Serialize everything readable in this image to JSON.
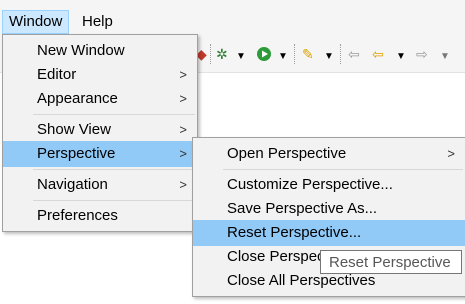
{
  "menubar": {
    "window_label": "Window",
    "help_label": "Help"
  },
  "toolbar": {
    "icons": [
      "bug-icon",
      "run-icon",
      "dropdown-icon",
      "pen-icon",
      "nav-back-icon",
      "nav-forward-icon"
    ]
  },
  "window_menu": {
    "items": [
      {
        "label": "New Window",
        "submenu": false
      },
      {
        "label": "Editor",
        "submenu": true
      },
      {
        "label": "Appearance",
        "submenu": true
      },
      {
        "label": "Show View",
        "submenu": true
      },
      {
        "label": "Perspective",
        "submenu": true,
        "highlighted": true
      },
      {
        "label": "Navigation",
        "submenu": true
      },
      {
        "label": "Preferences",
        "submenu": false
      }
    ]
  },
  "perspective_menu": {
    "items": [
      {
        "label": "Open Perspective",
        "submenu": true
      },
      {
        "label": "Customize Perspective...",
        "submenu": false
      },
      {
        "label": "Save Perspective As...",
        "submenu": false
      },
      {
        "label": "Reset Perspective...",
        "submenu": false,
        "highlighted": true
      },
      {
        "label": "Close Perspective",
        "submenu": false
      },
      {
        "label": "Close All Perspectives",
        "submenu": false
      }
    ]
  },
  "tooltip": {
    "text": "Reset Perspective"
  },
  "colors": {
    "highlight": "#91c9f7",
    "menu_bg": "#f2f2f2",
    "menubar_active": "#cce8ff"
  }
}
